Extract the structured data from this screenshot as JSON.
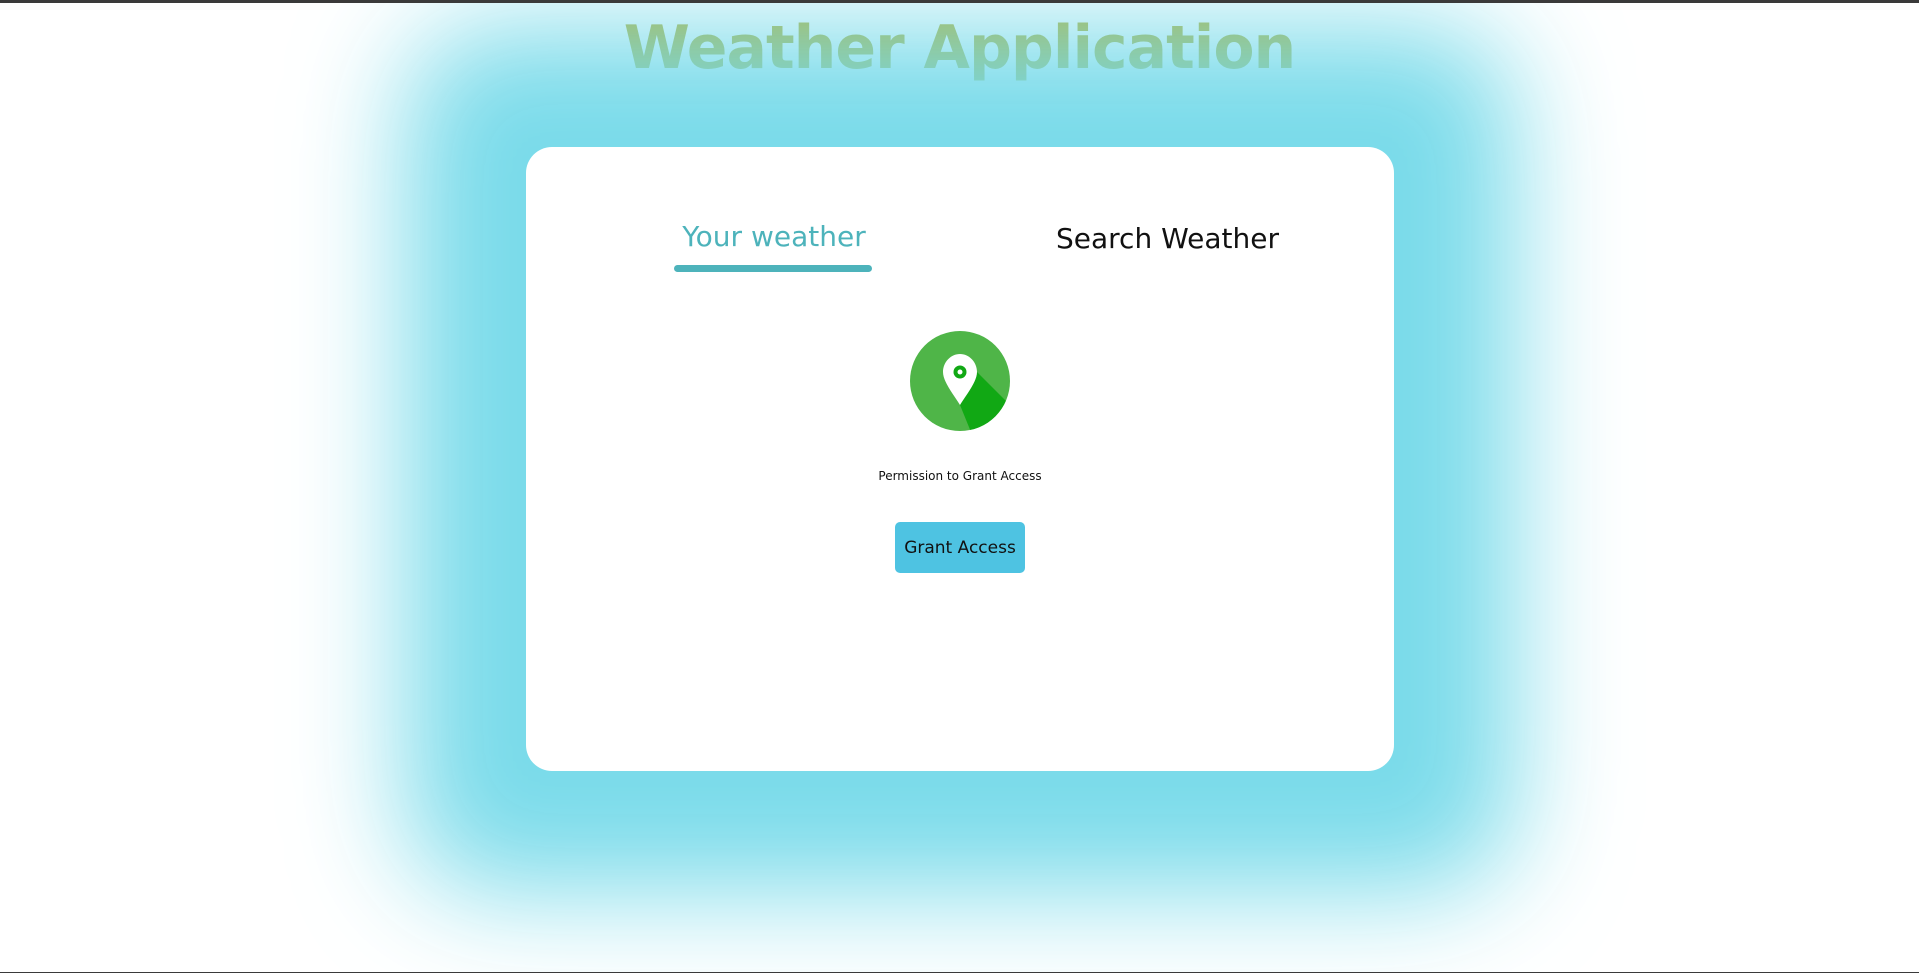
{
  "header": {
    "title": "Weather Application"
  },
  "tabs": [
    {
      "label": "Your weather",
      "active": true
    },
    {
      "label": "Search Weather",
      "active": false
    }
  ],
  "grant_access": {
    "icon": "location-pin-icon",
    "message": "Permission to Grant Access",
    "button_label": "Grant Access"
  },
  "colors": {
    "title": "#b9b33a",
    "active_tab": "#4db3bb",
    "glow": "#73d9e9",
    "icon_circle": "#4fb548",
    "icon_shadow": "#11a814",
    "button": "#4ec3e2"
  }
}
